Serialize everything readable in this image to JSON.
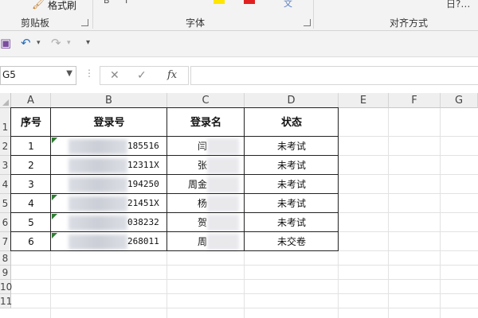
{
  "ribbon": {
    "clipboard_label": "剪贴板",
    "format_painter_label": "格式刷",
    "font_label": "字体",
    "alignment_label": "对齐方式",
    "cut_text_label": "日?…"
  },
  "qat": {
    "save_icon": "save-icon",
    "undo_icon": "undo-icon",
    "redo_icon": "redo-icon"
  },
  "formula_bar": {
    "name_box_value": "G5",
    "fx_label": "fx",
    "formula_value": ""
  },
  "columns": [
    "A",
    "B",
    "C",
    "D",
    "E",
    "F",
    "G"
  ],
  "rows": [
    "1",
    "2",
    "3",
    "4",
    "5",
    "6",
    "7",
    "8",
    "9",
    "10",
    "11"
  ],
  "table": {
    "headers": [
      "序号",
      "登录号",
      "登录名",
      "状态"
    ],
    "rows": [
      {
        "index": "1",
        "login_no": "185516",
        "login_name_prefix": "闫",
        "login_name_suffix": "",
        "status": "未考试"
      },
      {
        "index": "2",
        "login_no": "12311X",
        "login_name_prefix": "张",
        "login_name_suffix": "",
        "status": "未考试"
      },
      {
        "index": "3",
        "login_no": "194250",
        "login_name_prefix": "周金",
        "login_name_suffix": "",
        "status": "未考试"
      },
      {
        "index": "4",
        "login_no": "21451X",
        "login_name_prefix": "杨",
        "login_name_suffix": "",
        "status": "未考试"
      },
      {
        "index": "5",
        "login_no": "038232",
        "login_name_prefix": "贺",
        "login_name_suffix": "",
        "status": "未考试"
      },
      {
        "index": "6",
        "login_no": "268011",
        "login_name_prefix": "周",
        "login_name_suffix": "",
        "status": "未交卷"
      }
    ]
  },
  "colors": {
    "ribbon_bg": "#f3f3f3",
    "header_bg": "#efefef",
    "error_marker": "#2e7d32",
    "redacted": "#c9ccd4"
  }
}
